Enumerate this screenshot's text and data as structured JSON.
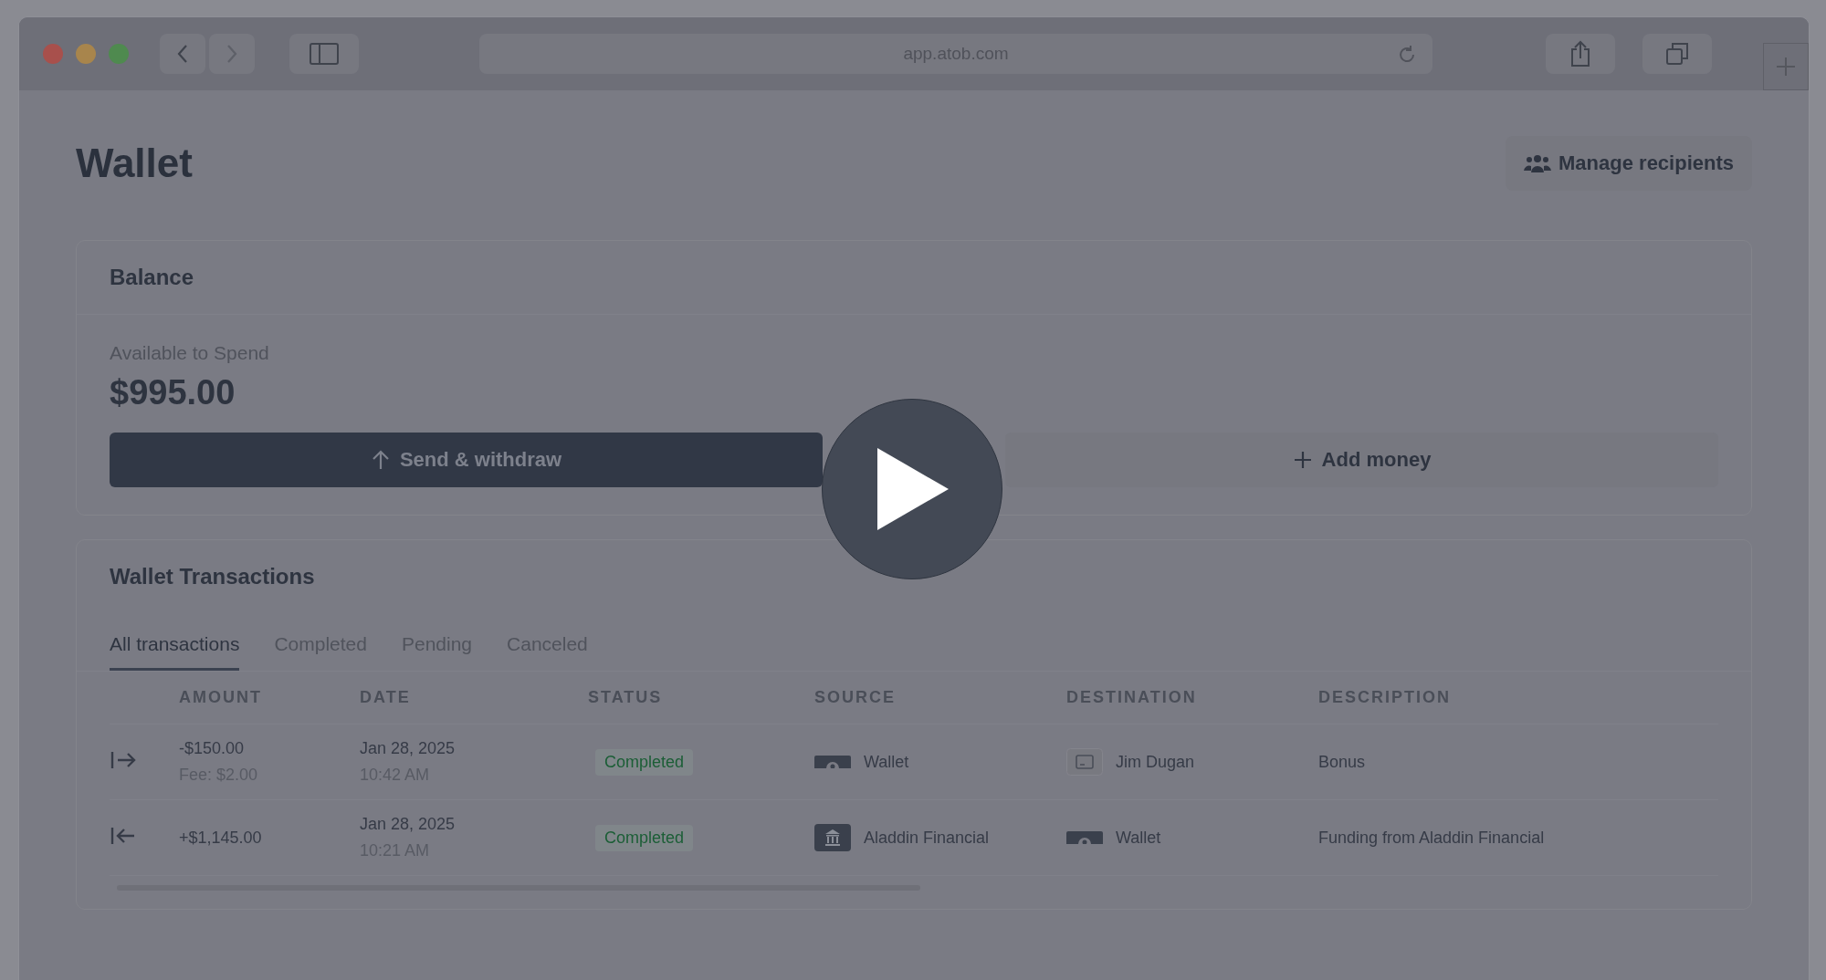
{
  "browser": {
    "url": "app.atob.com"
  },
  "page": {
    "title": "Wallet",
    "manage_button": "Manage recipients"
  },
  "balance": {
    "title": "Balance",
    "label": "Available to Spend",
    "amount": "$995.00",
    "buttons": [
      {
        "kind": "primary",
        "label": "Send & withdraw"
      },
      {
        "kind": "secondary",
        "label": "Add money"
      }
    ]
  },
  "transactions": {
    "title": "Wallet Transactions",
    "tabs": [
      {
        "label": "All transactions",
        "selected": true
      },
      {
        "label": "Completed",
        "selected": false
      },
      {
        "label": "Pending",
        "selected": false
      },
      {
        "label": "Canceled",
        "selected": false
      }
    ],
    "columns": [
      "AMOUNT",
      "DATE",
      "STATUS",
      "SOURCE",
      "DESTINATION",
      "DESCRIPTION"
    ],
    "rows": [
      {
        "kind": "outgoing",
        "amount": "-$150.00",
        "fee": "Fee: $2.00",
        "date": "Jan 28, 2025",
        "time": "10:42 AM",
        "status": "Completed",
        "source": {
          "kind": "wallet",
          "name": "Wallet"
        },
        "destination": {
          "kind": "card",
          "name": "Jim Dugan"
        },
        "description": "Bonus"
      },
      {
        "kind": "incoming",
        "amount": "+$1,145.00",
        "date": "Jan 28, 2025",
        "time": "10:21 AM",
        "status": "Completed",
        "source": {
          "kind": "bank",
          "name": "Aladdin Financial"
        },
        "destination": {
          "kind": "wallet",
          "name": "Wallet"
        },
        "description": "Funding from Aladdin Financial"
      }
    ]
  }
}
